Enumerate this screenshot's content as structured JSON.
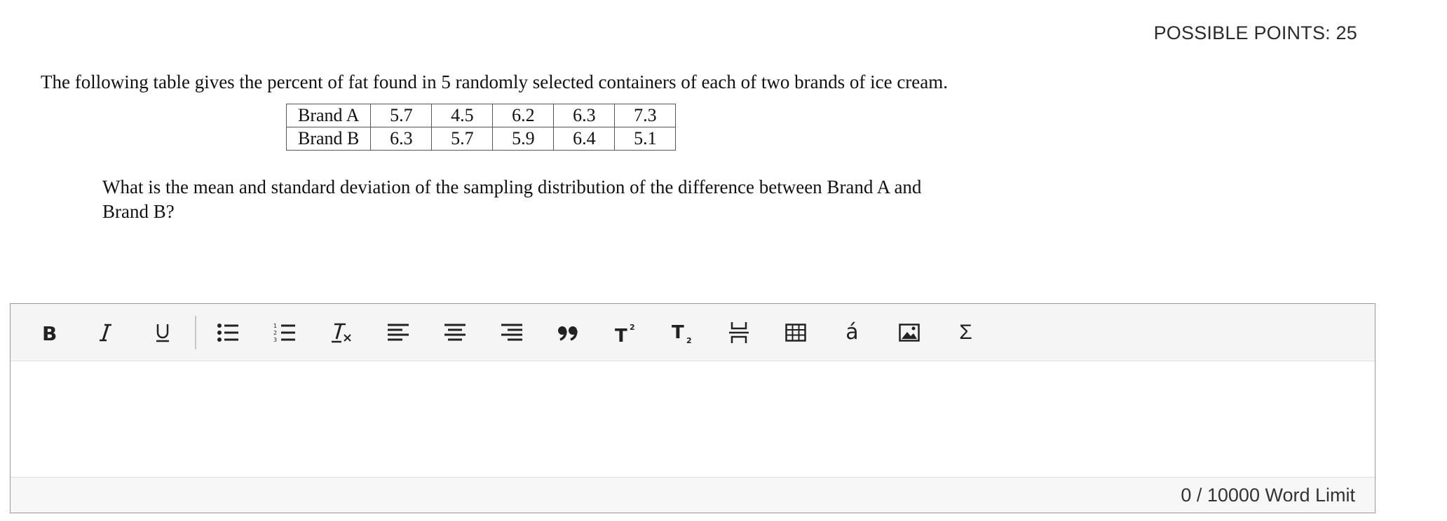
{
  "header": {
    "possible_points": "POSSIBLE POINTS: 25"
  },
  "question": {
    "intro": "The following table gives the percent of fat found in 5 randomly selected containers of each of two brands of ice cream.",
    "table": [
      {
        "brand": "Brand A",
        "values": [
          "5.7",
          "4.5",
          "6.2",
          "6.3",
          "7.3"
        ]
      },
      {
        "brand": "Brand B",
        "values": [
          "6.3",
          "5.7",
          "5.9",
          "6.4",
          "5.1"
        ]
      }
    ],
    "prompt": "What is the mean and standard deviation of the sampling distribution of the difference between Brand A and Brand B?"
  },
  "editor": {
    "toolbar": [
      {
        "name": "bold-button",
        "icon": "bold-icon"
      },
      {
        "name": "italic-button",
        "icon": "italic-icon"
      },
      {
        "name": "underline-button",
        "icon": "underline-icon"
      },
      {
        "name": "bulleted-list-button",
        "icon": "bulleted-list-icon"
      },
      {
        "name": "numbered-list-button",
        "icon": "numbered-list-icon"
      },
      {
        "name": "clear-formatting-button",
        "icon": "clear-formatting-icon"
      },
      {
        "name": "align-left-button",
        "icon": "align-left-icon"
      },
      {
        "name": "align-center-button",
        "icon": "align-center-icon"
      },
      {
        "name": "align-right-button",
        "icon": "align-right-icon"
      },
      {
        "name": "blockquote-button",
        "icon": "quote-icon"
      },
      {
        "name": "superscript-button",
        "icon": "superscript-icon"
      },
      {
        "name": "subscript-button",
        "icon": "subscript-icon"
      },
      {
        "name": "page-break-button",
        "icon": "page-break-icon"
      },
      {
        "name": "table-button",
        "icon": "table-icon"
      },
      {
        "name": "special-character-button",
        "icon": "accent-char-icon",
        "glyph": "á"
      },
      {
        "name": "image-button",
        "icon": "image-icon"
      },
      {
        "name": "math-equation-button",
        "icon": "sigma-icon",
        "glyph": "Σ"
      }
    ],
    "word_count": "0 / 10000 Word Limit"
  }
}
